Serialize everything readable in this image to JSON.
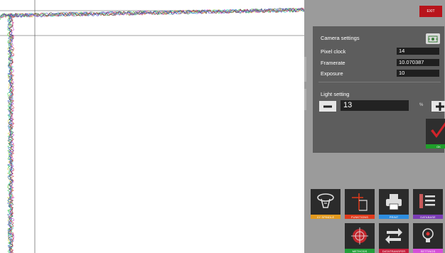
{
  "header": {
    "exit_label": "EXIT"
  },
  "camera_settings": {
    "title": "Camera settings",
    "fields": [
      {
        "label": "Pixel clock",
        "value": "14"
      },
      {
        "label": "Framerate",
        "value": "10.070387"
      },
      {
        "label": "Exposure",
        "value": "10"
      }
    ]
  },
  "light_setting": {
    "title": "Light setting",
    "value": "13",
    "unit": "%"
  },
  "ok_label": "OK",
  "tiles": [
    {
      "label": "XY SPINDLE",
      "color": "#e39a1e",
      "icon": "spindle-icon"
    },
    {
      "label": "FUNKTIONS",
      "color": "#e03a1b",
      "icon": "functions-icon"
    },
    {
      "label": "PRINT",
      "color": "#2d8de0",
      "icon": "printer-icon"
    },
    {
      "label": "DATABASE",
      "color": "#7a3cb5",
      "icon": "database-icon"
    },
    {
      "label": "METHODS",
      "color": "#22a03a",
      "icon": "crosshair-icon"
    },
    {
      "label": "DATATRANSFER",
      "color": "#c81f3d",
      "icon": "transfer-icon"
    },
    {
      "label": "SETTINGS",
      "color": "#d54fd8",
      "icon": "lightbulb-icon"
    }
  ]
}
